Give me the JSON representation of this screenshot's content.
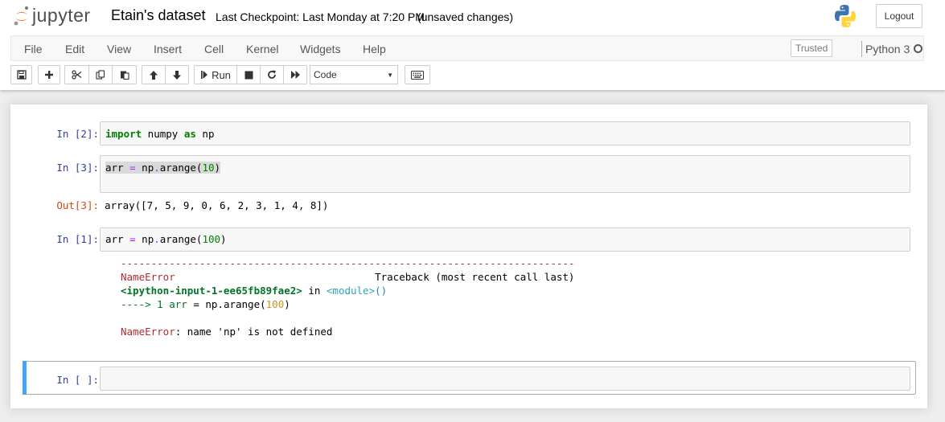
{
  "header": {
    "logo_text": "jupyter",
    "notebook_title": "Etain's dataset",
    "checkpoint": "Last Checkpoint: Last Monday at 7:20 PM",
    "autosave_status": "(unsaved changes)",
    "logout_label": "Logout"
  },
  "menu": {
    "items": [
      "File",
      "Edit",
      "View",
      "Insert",
      "Cell",
      "Kernel",
      "Widgets",
      "Help"
    ],
    "trusted_label": "Trusted",
    "kernel_name": "Python 3"
  },
  "toolbar": {
    "icons": [
      "save-icon",
      "plus-icon",
      "scissors-icon",
      "copy-icon",
      "paste-icon",
      "arrow-up-icon",
      "arrow-down-icon",
      "run-icon",
      "stop-icon",
      "restart-icon",
      "fast-forward-icon",
      "keyboard-icon"
    ],
    "run_label": "Run",
    "cell_type": "Code"
  },
  "cells": [
    {
      "prompt": "In [2]:",
      "code": [
        {
          "t": "import",
          "c": "kw"
        },
        {
          "t": " numpy ",
          "c": ""
        },
        {
          "t": "as",
          "c": "kw"
        },
        {
          "t": " np",
          "c": ""
        }
      ]
    },
    {
      "prompt": "In [3]:",
      "code": [
        {
          "t": "arr ",
          "c": ""
        },
        {
          "t": "=",
          "c": "op"
        },
        {
          "t": " np",
          "c": ""
        },
        {
          "t": ".",
          "c": "op"
        },
        {
          "t": "arange(",
          "c": ""
        },
        {
          "t": "10",
          "c": "num"
        },
        {
          "t": ")",
          "c": ""
        }
      ],
      "out_prompt": "Out[3]:",
      "output": "array([7, 5, 9, 0, 6, 2, 3, 1, 4, 8])"
    },
    {
      "prompt": "In [1]:",
      "code": [
        {
          "t": "arr ",
          "c": ""
        },
        {
          "t": "=",
          "c": "op"
        },
        {
          "t": " np",
          "c": ""
        },
        {
          "t": ".",
          "c": "op"
        },
        {
          "t": "arange(",
          "c": ""
        },
        {
          "t": "100",
          "c": "num"
        },
        {
          "t": ")",
          "c": ""
        }
      ],
      "traceback": {
        "dashes": "---------------------------------------------------------------------------",
        "error_name": "NameError",
        "spacer": "                                 ",
        "traceback_label": "Traceback (most recent call last)",
        "input_ref": "<ipython-input-1-ee65fb89fae2>",
        "in_word": " in ",
        "module_ref": "<module>",
        "module_paren": "()",
        "arrow": "----> 1 arr ",
        "eq": "=",
        "rest_before": " np",
        "dot": ".",
        "rest_call": "arange(",
        "arg": "100",
        "close": ")",
        "final_error_name": "NameError",
        "final_message": ": name 'np' is not defined"
      }
    },
    {
      "prompt": "In [ ]:"
    }
  ],
  "colors": {
    "prompt_in": "#303f9f",
    "prompt_out": "#d84315",
    "selected_bar": "#42a5f5"
  }
}
